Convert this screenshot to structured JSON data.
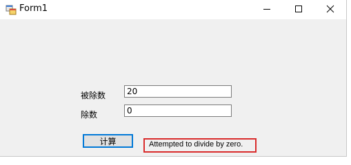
{
  "window": {
    "title": "Form1"
  },
  "form": {
    "dividend_label": "被除数",
    "dividend_value": "20",
    "divisor_label": "除数",
    "divisor_value": "0",
    "calc_button_label": "计算",
    "result_text": "Attempted to divide by zero."
  },
  "icons": {
    "app": "form-app-icon",
    "minimize": "minimize-icon",
    "maximize": "maximize-icon",
    "close": "close-icon"
  },
  "colors": {
    "window_bg": "#f0f0f0",
    "titlebar_bg": "#ffffff",
    "button_focus_border": "#0078d7",
    "highlight_border": "#d92b2b"
  }
}
